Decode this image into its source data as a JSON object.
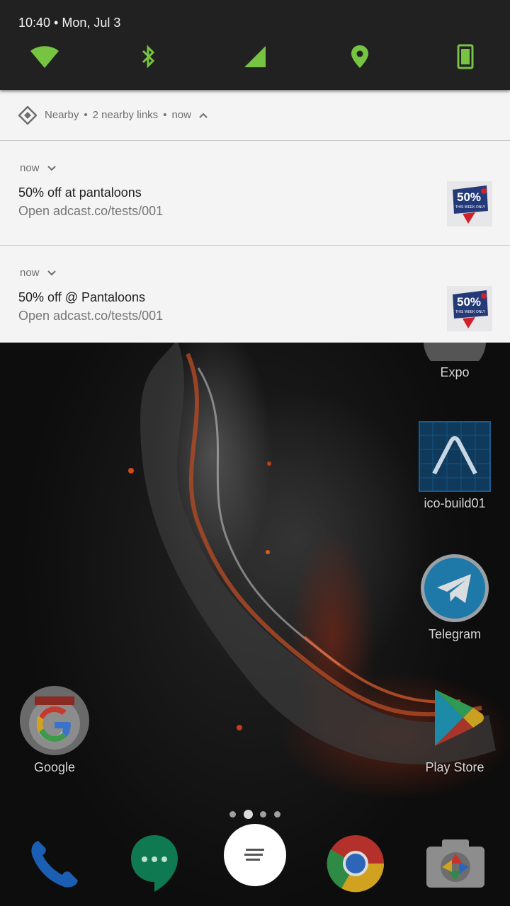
{
  "status": {
    "time_date": "10:40 • Mon, Jul 3",
    "icons": [
      "wifi-icon",
      "bluetooth-icon",
      "cellular-signal-icon",
      "location-icon",
      "auto-rotate-icon"
    ],
    "accent": "#76c442"
  },
  "nearby": {
    "app": "Nearby",
    "summary": "2 nearby links",
    "time": "now"
  },
  "notifications": [
    {
      "time": "now",
      "title": "50% off at pantaloons",
      "body": "Open adcast.co/tests/001",
      "thumb_text": "50%",
      "thumb_sub": "THIS WEEK ONLY"
    },
    {
      "time": "now",
      "title": "50% off @ Pantaloons",
      "body": "Open adcast.co/tests/001",
      "thumb_text": "50%",
      "thumb_sub": "THIS WEEK ONLY"
    }
  ],
  "home": {
    "apps": {
      "expo": "Expo",
      "ico_build": "ico-build01",
      "telegram": "Telegram",
      "google": "Google",
      "play_store": "Play Store"
    },
    "dock": [
      "phone-icon",
      "hangouts-icon",
      "app-drawer-icon",
      "chrome-icon",
      "camera-icon"
    ],
    "page_dots": 4,
    "active_page": 1
  }
}
